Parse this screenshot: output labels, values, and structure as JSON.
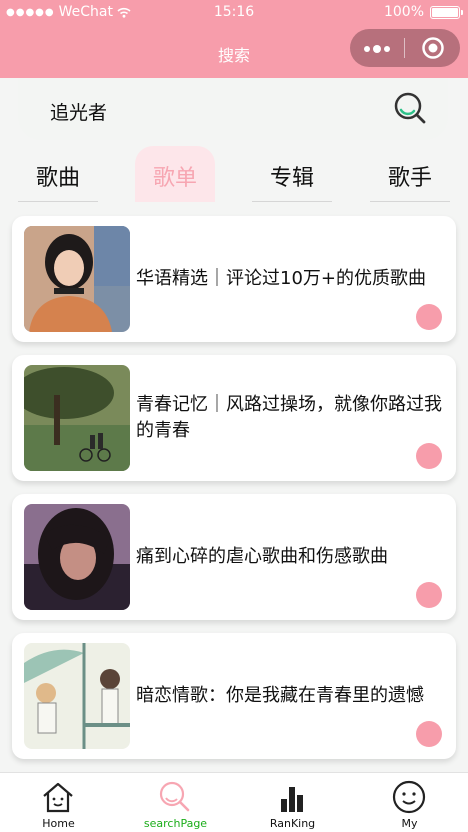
{
  "status_bar": {
    "carrier": "WeChat",
    "time": "15:16",
    "battery": "100%",
    "battery_level": 1.0
  },
  "nav": {
    "title": "搜索",
    "more_icon": "more-dots-icon",
    "close_icon": "target-icon"
  },
  "search": {
    "query": "追光者",
    "icon": "search-icon"
  },
  "tabs": [
    {
      "label": "歌曲",
      "active": false
    },
    {
      "label": "歌单",
      "active": true
    },
    {
      "label": "专辑",
      "active": false
    },
    {
      "label": "歌手",
      "active": false
    }
  ],
  "results": [
    {
      "title": "华语精选｜评论过10万+的优质歌曲",
      "cover": "girl-portrait-cover"
    },
    {
      "title": "青春记忆｜风路过操场，就像你路过我的青春",
      "cover": "tree-bicycle-cover"
    },
    {
      "title": "痛到心碎的虐心歌曲和伤感歌曲",
      "cover": "dark-portrait-cover"
    },
    {
      "title": "暗恋情歌：你是我藏在青春里的遗憾",
      "cover": "anime-couple-cover"
    }
  ],
  "tabbar": [
    {
      "label": "Home",
      "icon": "home-icon",
      "active": false
    },
    {
      "label": "searchPage",
      "icon": "search-icon",
      "active": true
    },
    {
      "label": "RanKing",
      "icon": "bar-chart-icon",
      "active": false
    },
    {
      "label": "My",
      "icon": "smiley-icon",
      "active": false
    }
  ],
  "colors": {
    "brand": "#f79dab",
    "active_tab_text": "#f7a6b2",
    "active_tab_bg": "#fde6ea",
    "tabbar_active": "#1aad19"
  }
}
